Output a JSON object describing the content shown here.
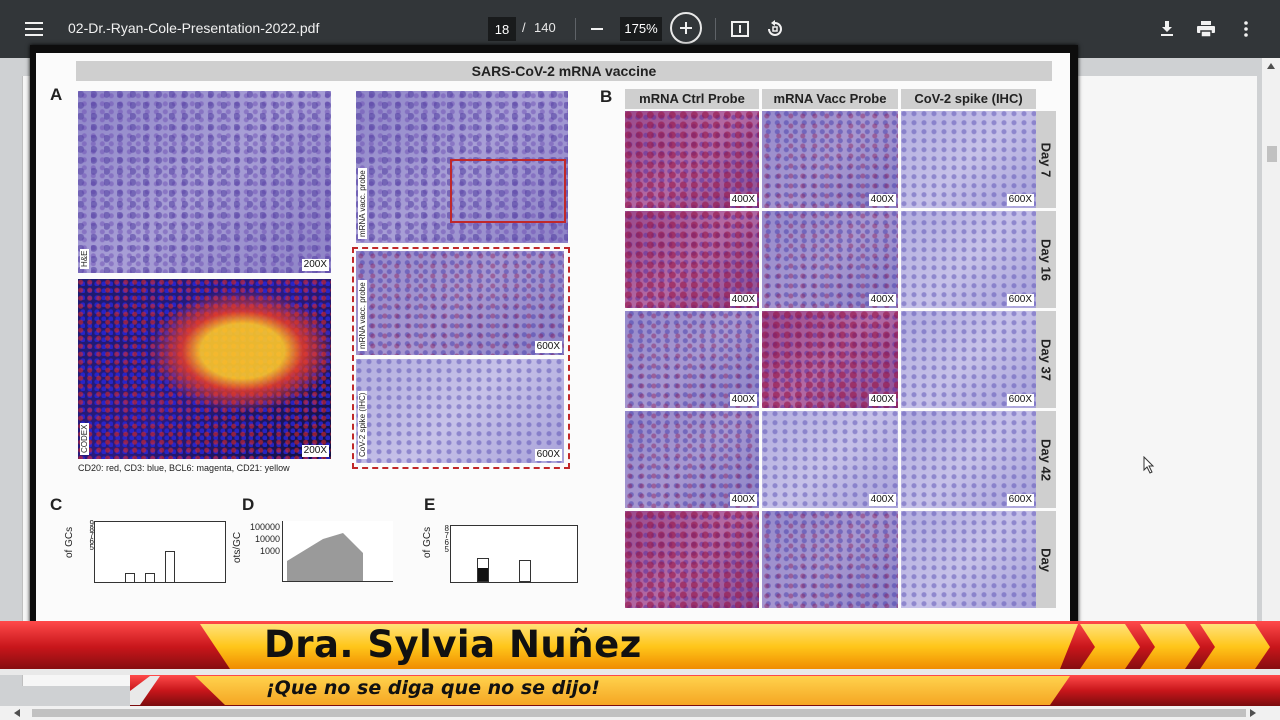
{
  "toolbar": {
    "menu_icon": "hamburger-menu-icon",
    "title": "02-Dr.-Ryan-Cole-Presentation-2022.pdf",
    "page_current": "18",
    "page_separator": "/",
    "page_total": "140",
    "zoom": "175%",
    "icons": [
      "minus-icon",
      "plus-icon",
      "fit-page-icon",
      "rotate-icon",
      "download-icon",
      "print-icon",
      "more-vert-icon"
    ]
  },
  "figure": {
    "title": "SARS-CoV-2 mRNA vaccine",
    "panel_a": {
      "letter": "A",
      "he_label": "H&E",
      "he_mag": "200X",
      "codex_label": "CODEX",
      "codex_mag": "200X",
      "legend": "CD20: red, CD3: blue, BCL6: magenta, CD21: yellow",
      "probe_top_label": "mRNA vacc. probe",
      "probe_mid_label": "mRNA vacc. probe",
      "probe_mid_mag": "600X",
      "spike_label": "CoV-2 spike (IHC)",
      "spike_mag": "600X"
    },
    "panel_b": {
      "letter": "B",
      "columns": [
        "mRNA Ctrl Probe",
        "mRNA Vacc Probe",
        "CoV-2 spike (IHC)"
      ],
      "rows": [
        {
          "day": "Day 7",
          "mags": [
            "400X",
            "400X",
            "600X"
          ]
        },
        {
          "day": "Day 16",
          "mags": [
            "400X",
            "400X",
            "600X"
          ]
        },
        {
          "day": "Day 37",
          "mags": [
            "400X",
            "400X",
            "600X"
          ]
        },
        {
          "day": "Day 42",
          "mags": [
            "400X",
            "400X",
            "600X"
          ]
        },
        {
          "day": "Day",
          "mags": [
            "",
            "",
            ""
          ]
        }
      ]
    },
    "panel_c": {
      "letter": "C",
      "ylabel": "of GCs",
      "ticks": [
        "9",
        "8",
        "7",
        "6",
        "5"
      ]
    },
    "panel_d": {
      "letter": "D",
      "ylabel": "ots/GC",
      "ticks": [
        "100000",
        "10000",
        "1000"
      ]
    },
    "panel_e": {
      "letter": "E",
      "ylabel": "of GCs",
      "ticks": [
        "8",
        "7",
        "6",
        "5"
      ]
    }
  },
  "banner": {
    "name": "Dra. Sylvia Nuñez",
    "slogan": "¡Que no se diga que no se dijo!"
  },
  "colors": {
    "toolbar_bg": "#323639",
    "viewer_bg": "#cfd1d3",
    "banner_red": "#c8161b",
    "banner_yellow": "#ffcc33",
    "banner_orange": "#f5a623"
  }
}
